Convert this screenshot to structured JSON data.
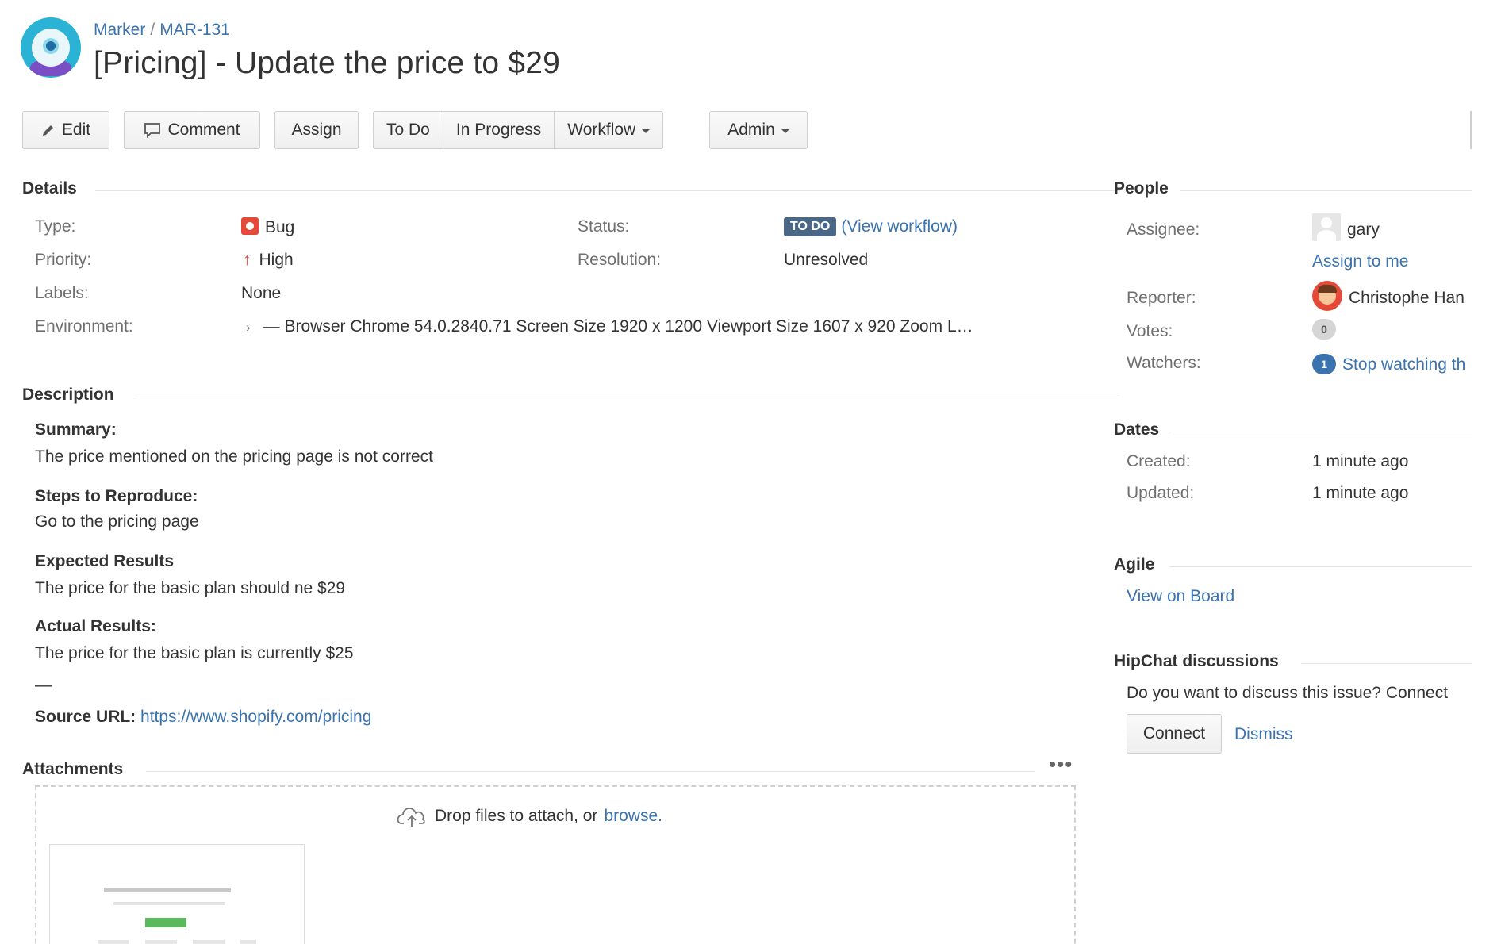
{
  "breadcrumb": {
    "project": "Marker",
    "separator": "/",
    "issue_key": "MAR-131"
  },
  "issue": {
    "title": "[Pricing] - Update the price to $29"
  },
  "toolbar": {
    "edit": "Edit",
    "comment": "Comment",
    "assign": "Assign",
    "todo": "To Do",
    "in_progress": "In Progress",
    "workflow": "Workflow",
    "admin": "Admin"
  },
  "details": {
    "heading": "Details",
    "type_label": "Type:",
    "type_value": "Bug",
    "priority_label": "Priority:",
    "priority_value": "High",
    "labels_label": "Labels:",
    "labels_value": "None",
    "environment_label": "Environment:",
    "environment_value": "— Browser Chrome 54.0.2840.71 Screen Size 1920 x 1200 Viewport Size 1607 x 920 Zoom L…",
    "status_label": "Status:",
    "status_value": "TO DO",
    "status_link": "(View workflow)",
    "resolution_label": "Resolution:",
    "resolution_value": "Unresolved"
  },
  "description": {
    "heading": "Description",
    "summary_label": "Summary:",
    "summary_text": "The price mentioned on the pricing page is not correct",
    "steps_label": "Steps to Reproduce:",
    "steps_text": "Go to the pricing page",
    "expected_label": "Expected Results",
    "expected_text": "The price for the basic plan should ne $29",
    "actual_label": "Actual Results:",
    "actual_text": "The price for the basic plan is currently $25",
    "divider": "—",
    "source_label": "Source URL:",
    "source_url": "https://www.shopify.com/pricing"
  },
  "attachments": {
    "heading": "Attachments",
    "more": "•••",
    "drop_text": "Drop files to attach, or",
    "browse_link": "browse."
  },
  "people": {
    "heading": "People",
    "assignee_label": "Assignee:",
    "assignee_name": "gary",
    "assign_to_me": "Assign to me",
    "reporter_label": "Reporter:",
    "reporter_name": "Christophe Han",
    "votes_label": "Votes:",
    "votes_count": "0",
    "watchers_label": "Watchers:",
    "watchers_count": "1",
    "stop_watching": "Stop watching th"
  },
  "dates": {
    "heading": "Dates",
    "created_label": "Created:",
    "created_value": "1 minute ago",
    "updated_label": "Updated:",
    "updated_value": "1 minute ago"
  },
  "agile": {
    "heading": "Agile",
    "view_on_board": "View on Board"
  },
  "hipchat": {
    "heading": "HipChat discussions",
    "prompt": "Do you want to discuss this issue? Connect",
    "connect": "Connect",
    "dismiss": "Dismiss"
  }
}
